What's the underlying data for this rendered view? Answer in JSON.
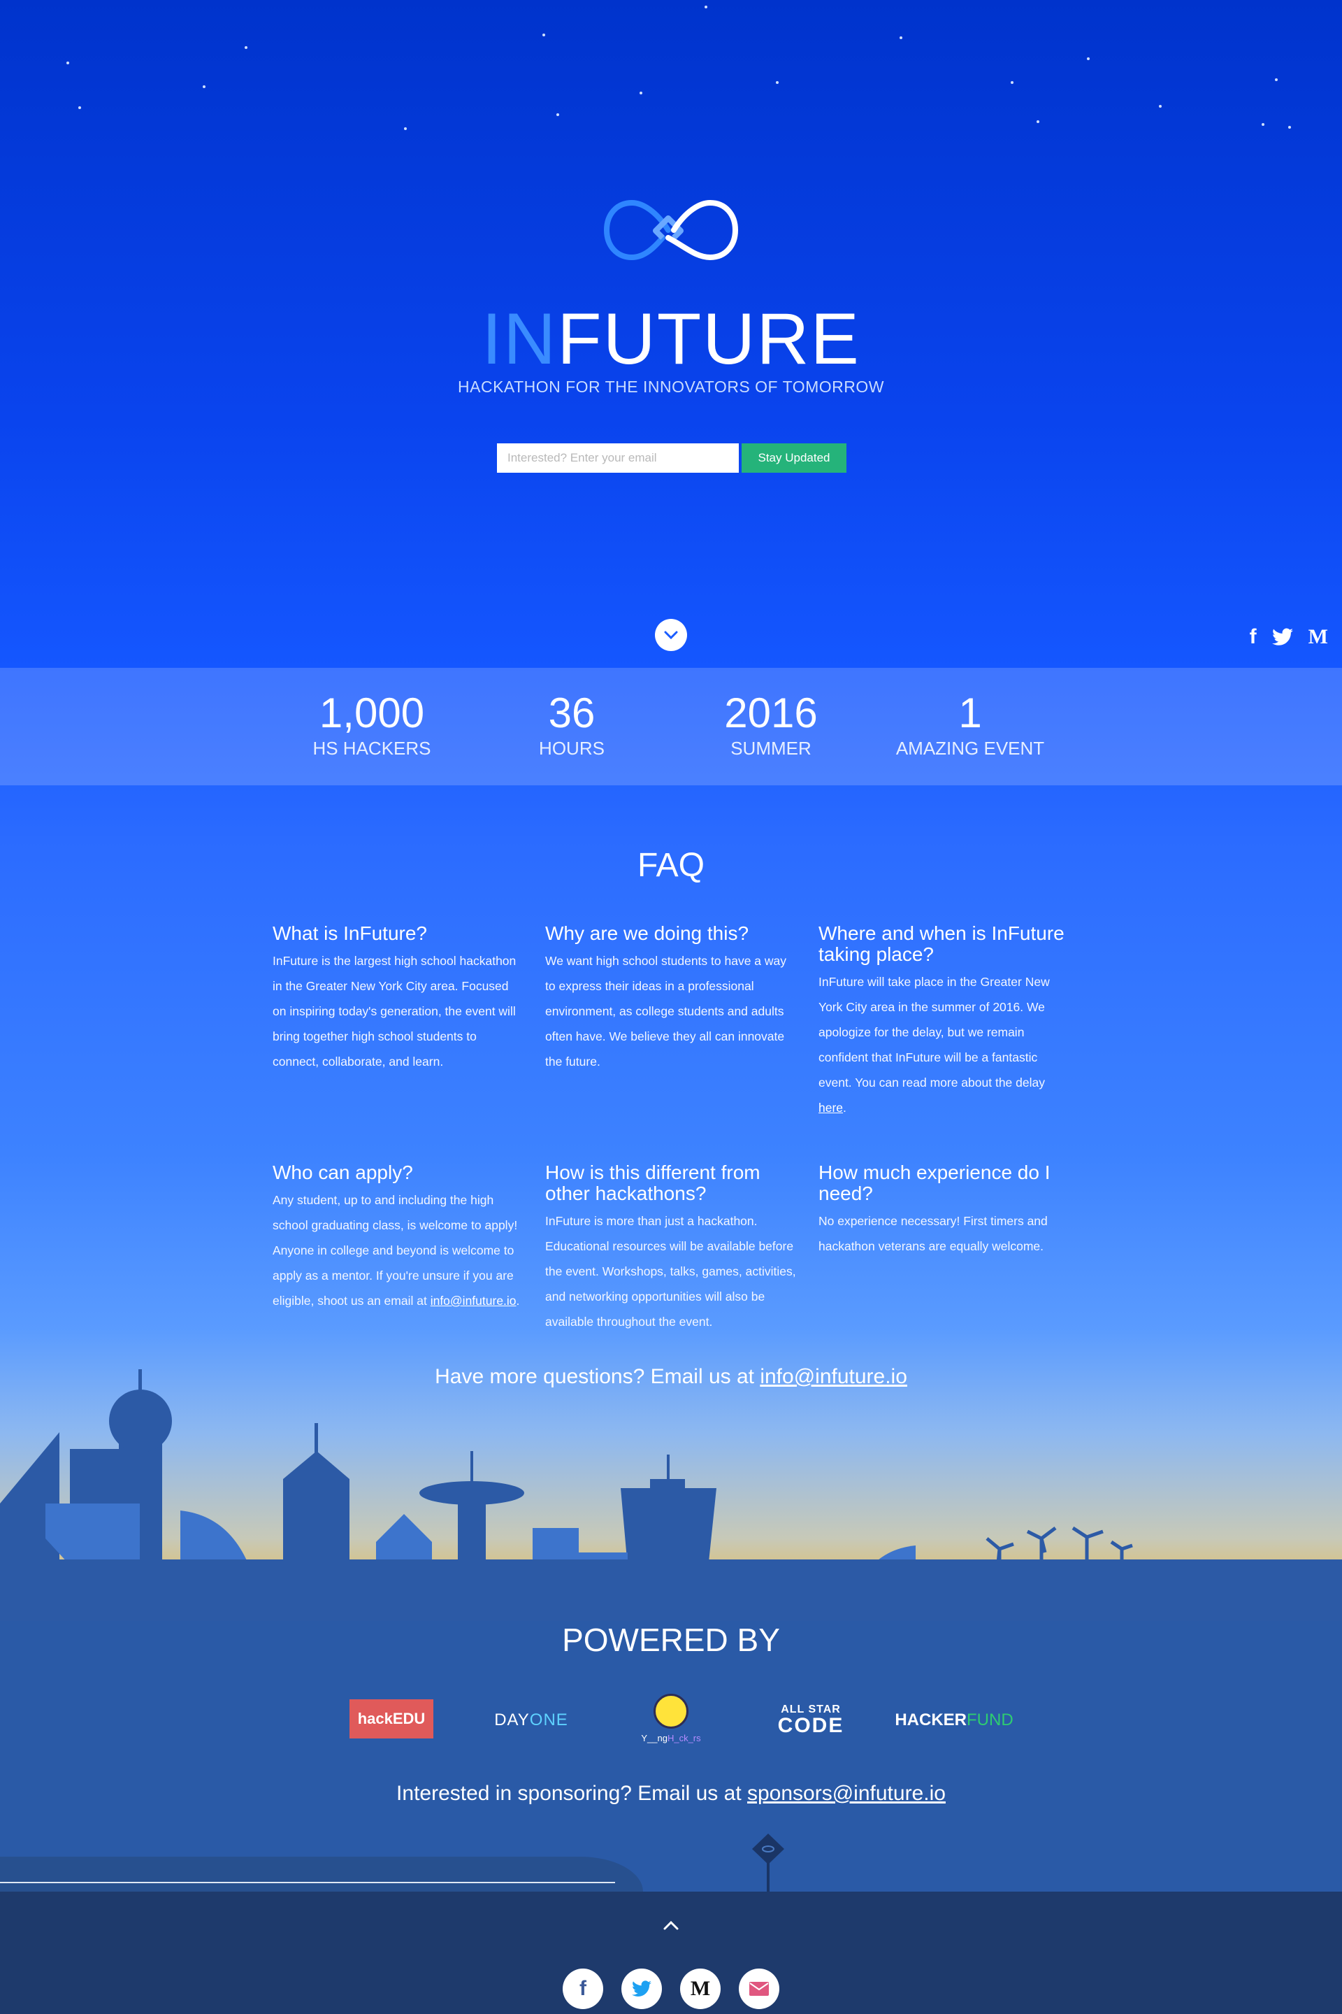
{
  "hero": {
    "title_prefix": "IN",
    "title_rest": "FUTURE",
    "tagline": "HACKATHON FOR THE INNOVATORS OF TOMORROW",
    "email_placeholder": "Interested? Enter your email",
    "cta_label": "Stay Updated",
    "social": [
      "facebook-icon",
      "twitter-icon",
      "medium-icon"
    ],
    "social_glyphs": {
      "facebook": "f",
      "medium": "M"
    }
  },
  "stats": [
    {
      "value": "1,000",
      "label": "HS HACKERS"
    },
    {
      "value": "36",
      "label": "HOURS"
    },
    {
      "value": "2016",
      "label": "SUMMER"
    },
    {
      "value": "1",
      "label": "AMAZING EVENT"
    }
  ],
  "faq": {
    "title": "FAQ",
    "items": [
      {
        "q": "What is InFuture?",
        "a": "InFuture is the largest high school hackathon in the Greater New York City area. Focused on inspiring today's generation, the event will bring together high school students to connect, collaborate, and learn."
      },
      {
        "q": "Why are we doing this?",
        "a": "We want high school students to have a way to express their ideas in a professional environment, as college students and adults often have. We believe they all can innovate the future."
      },
      {
        "q": "Where and when is InFuture taking place?",
        "a": "InFuture will take place in the Greater New York City area in the summer of 2016. We apologize for the delay, but we remain confident that InFuture will be a fantastic event. You can read more about the delay",
        "link": "here",
        "after": "."
      },
      {
        "q": "Who can apply?",
        "a": "Any student, up to and including the high school graduating class, is welcome to apply! Anyone in college and beyond is welcome to apply as a mentor. If you're unsure if you are eligible, shoot us an email at",
        "link": "info@infuture.io",
        "after": "."
      },
      {
        "q": "How is this different from other hackathons?",
        "a": "InFuture is more than just a hackathon. Educational resources will be available before the event. Workshops, talks, games, activities, and networking opportunities will also be available throughout the event."
      },
      {
        "q": "How much experience do I need?",
        "a": "No experience necessary! First timers and hackathon veterans are equally welcome."
      }
    ],
    "more_text": "Have more questions? Email us at",
    "more_email": "info@infuture.io"
  },
  "powered": {
    "title": "POWERED BY",
    "sponsors": {
      "hackedu": "hackEDU",
      "dayone_a": "DAY ",
      "dayone_b": "ONE",
      "young_a": "Y__ng",
      "young_b": "H_ck_rs",
      "allstar_a": "ALL STAR",
      "allstar_b": "CODE",
      "hacker_a": "HACKER",
      "hacker_b": "FUND"
    },
    "sponsor_text": "Interested in sponsoring? Email us at",
    "sponsor_email": "sponsors@infuture.io"
  },
  "footer": {
    "icons": [
      "facebook-icon",
      "twitter-icon",
      "medium-icon",
      "email-icon"
    ]
  },
  "colors": {
    "accent": "#3a8cff",
    "cta": "#25b37a",
    "ground": "#2a5aa7",
    "footer": "#1e3a6c",
    "facebook": "#3b5998",
    "twitter": "#1da1f2",
    "email": "#e0577f"
  }
}
